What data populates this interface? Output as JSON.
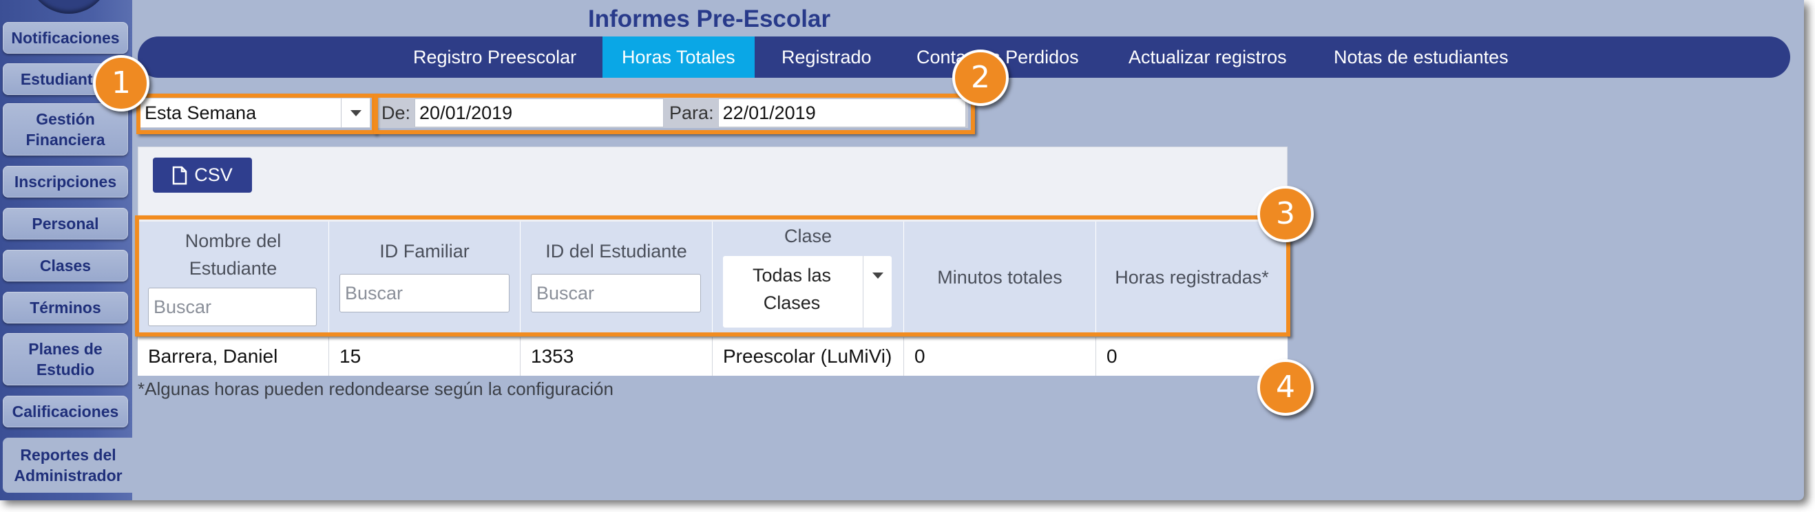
{
  "page_title": "Informes Pre-Escolar",
  "sidebar": {
    "items": [
      {
        "label": "Notificaciones"
      },
      {
        "label": "Estudiantes"
      },
      {
        "label": "Gestión Financiera"
      },
      {
        "label": "Inscripciones"
      },
      {
        "label": "Personal"
      },
      {
        "label": "Clases"
      },
      {
        "label": "Términos"
      },
      {
        "label": "Planes de Estudio"
      },
      {
        "label": "Calificaciones"
      },
      {
        "label": "Reportes del Administrador"
      }
    ]
  },
  "tabs": [
    {
      "label": "Registro Preescolar"
    },
    {
      "label": "Horas Totales"
    },
    {
      "label": "Registrado"
    },
    {
      "label": "Contactos Perdidos"
    },
    {
      "label": "Actualizar registros"
    },
    {
      "label": "Notas de estudiantes"
    }
  ],
  "filters": {
    "period": "Esta Semana",
    "from_label": "De:",
    "from_value": "20/01/2019",
    "to_label": "Para:",
    "to_value": "22/01/2019"
  },
  "csv_label": "CSV",
  "table": {
    "columns": {
      "student_name": "Nombre del Estudiante",
      "family_id": "ID Familiar",
      "student_id": "ID del Estudiante",
      "class": "Clase",
      "total_minutes": "Minutos totales",
      "hours_registered": "Horas registradas*"
    },
    "search_placeholder": "Buscar",
    "class_filter_value": "Todas las Clases",
    "rows": [
      {
        "student_name": "Barrera, Daniel",
        "family_id": "15",
        "student_id": "1353",
        "class": "Preescolar (LuMiVi)",
        "total_minutes": "0",
        "hours_registered": "0"
      }
    ]
  },
  "footnote": "*Algunas horas pueden redondearse según la configuración",
  "callouts": [
    "1",
    "2",
    "3",
    "4"
  ],
  "colors": {
    "nav_bg": "#2e3d87",
    "active_tab": "#0aa7e6",
    "highlight": "#f28c1f",
    "title": "#283a8a"
  }
}
